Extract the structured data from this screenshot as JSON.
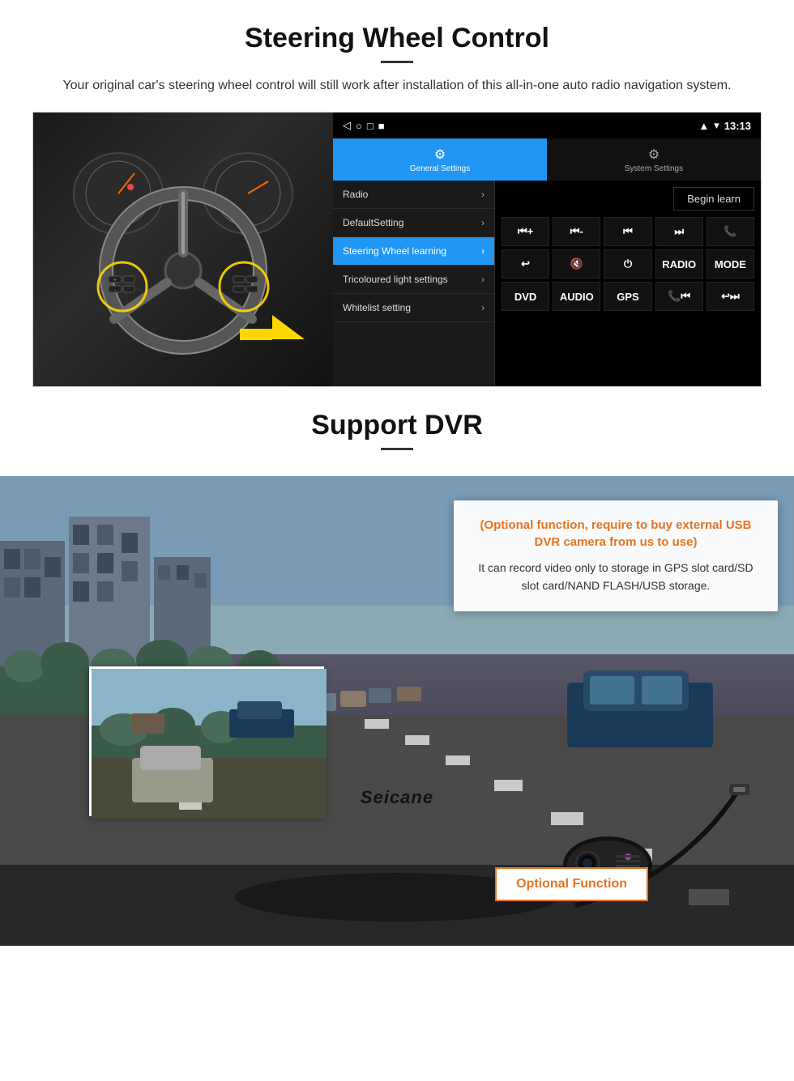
{
  "steering": {
    "section_title": "Steering Wheel Control",
    "section_desc": "Your original car's steering wheel control will still work after installation of this all-in-one auto radio navigation system.",
    "status_bar": {
      "time": "13:13",
      "signal_icon": "▲",
      "wifi_icon": "▾",
      "battery_icon": "▪"
    },
    "nav_icons": [
      "◁",
      "○",
      "□",
      "■"
    ],
    "tabs": {
      "general": {
        "icon": "⚙",
        "label": "General Settings"
      },
      "system": {
        "icon": "⚙",
        "label": "System Settings"
      }
    },
    "menu_items": [
      {
        "label": "Radio",
        "active": false
      },
      {
        "label": "DefaultSetting",
        "active": false
      },
      {
        "label": "Steering Wheel learning",
        "active": true
      },
      {
        "label": "Tricoloured light settings",
        "active": false
      },
      {
        "label": "Whitelist setting",
        "active": false
      }
    ],
    "begin_learn_label": "Begin learn",
    "control_buttons": [
      [
        "⏮+",
        "⏮-",
        "⏮",
        "⏭",
        "📞"
      ],
      [
        "↩",
        "🔇",
        "⏻",
        "RADIO",
        "MODE"
      ],
      [
        "DVD",
        "AUDIO",
        "GPS",
        "📞⏮",
        "↩⏭"
      ]
    ]
  },
  "dvr": {
    "section_title": "Support DVR",
    "optional_title": "(Optional function, require to buy external USB DVR camera from us to use)",
    "desc": "It can record video only to storage in GPS slot card/SD slot card/NAND FLASH/USB storage.",
    "seicane_logo": "Seicane",
    "optional_btn_label": "Optional Function"
  }
}
